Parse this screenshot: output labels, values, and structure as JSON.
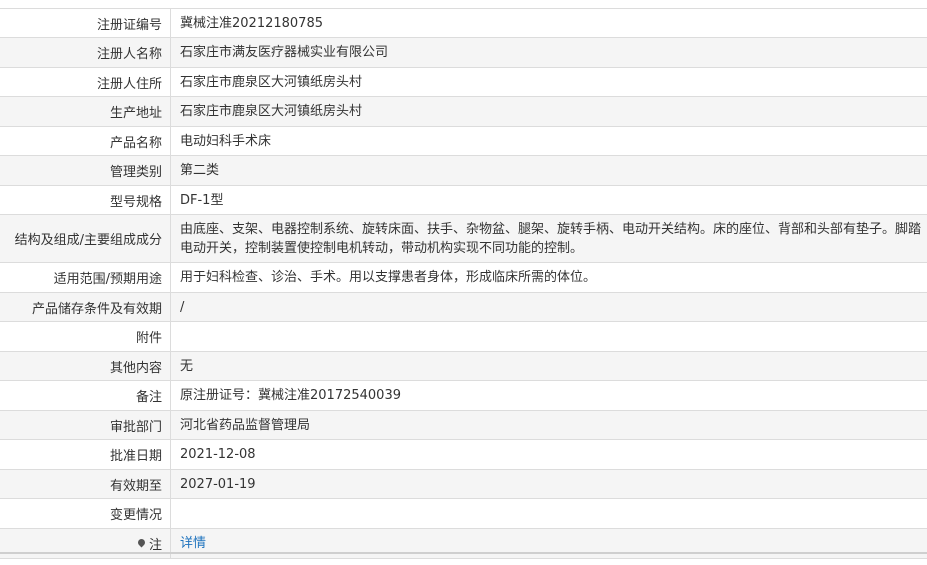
{
  "rows": [
    {
      "label": "注册证编号",
      "value": "冀械注准20212180785"
    },
    {
      "label": "注册人名称",
      "value": "石家庄市满友医疗器械实业有限公司"
    },
    {
      "label": "注册人住所",
      "value": "石家庄市鹿泉区大河镇纸房头村"
    },
    {
      "label": "生产地址",
      "value": "石家庄市鹿泉区大河镇纸房头村"
    },
    {
      "label": "产品名称",
      "value": "电动妇科手术床"
    },
    {
      "label": "管理类别",
      "value": "第二类"
    },
    {
      "label": "型号规格",
      "value": "DF-1型"
    },
    {
      "label": "结构及组成/主要组成成分",
      "value": "由底座、支架、电器控制系统、旋转床面、扶手、杂物盆、腿架、旋转手柄、电动开关结构。床的座位、背部和头部有垫子。脚踏电动开关，控制装置使控制电机转动，带动机构实现不同功能的控制。"
    },
    {
      "label": "适用范围/预期用途",
      "value": "用于妇科检查、诊治、手术。用以支撑患者身体，形成临床所需的体位。"
    },
    {
      "label": "产品储存条件及有效期",
      "value": "/"
    },
    {
      "label": "附件",
      "value": ""
    },
    {
      "label": "其他内容",
      "value": "无"
    },
    {
      "label": "备注",
      "value": "原注册证号：冀械注准20172540039"
    },
    {
      "label": "审批部门",
      "value": "河北省药品监督管理局"
    },
    {
      "label": "批准日期",
      "value": "2021-12-08"
    },
    {
      "label": "有效期至",
      "value": "2027-01-19"
    },
    {
      "label": "变更情况",
      "value": ""
    },
    {
      "label": "注",
      "value": "详情"
    }
  ],
  "icons": {
    "note_label_icon": "pin-icon"
  },
  "colors": {
    "link": "#1e73be",
    "border": "#dcdcdc",
    "stripe": "#f5f5f5"
  }
}
